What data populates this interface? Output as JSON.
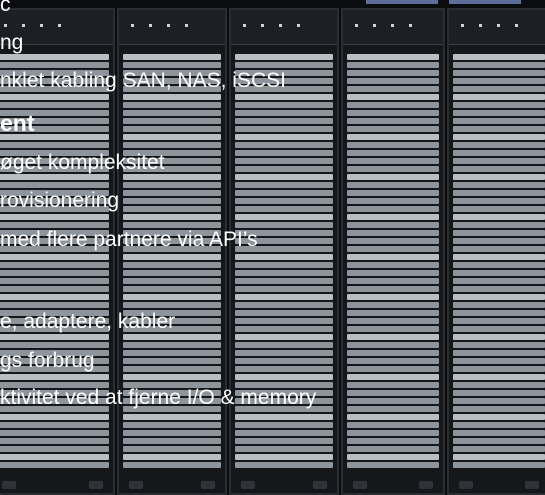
{
  "lines": [
    {
      "text": "c"
    },
    {
      "text": "ng"
    },
    {
      "text": "nklet kabling SAN, NAS, iSCSI"
    },
    {
      "text": "ent"
    },
    {
      "text": "øget kompleksitet"
    },
    {
      "text": "rovisionering"
    },
    {
      "text": "med flere partnere via API’s"
    },
    {
      "text": "e, adaptere, kabler"
    },
    {
      "text": "gs forbrug"
    },
    {
      "text": "ktivitet ved at fjerne I/O & memory"
    }
  ]
}
